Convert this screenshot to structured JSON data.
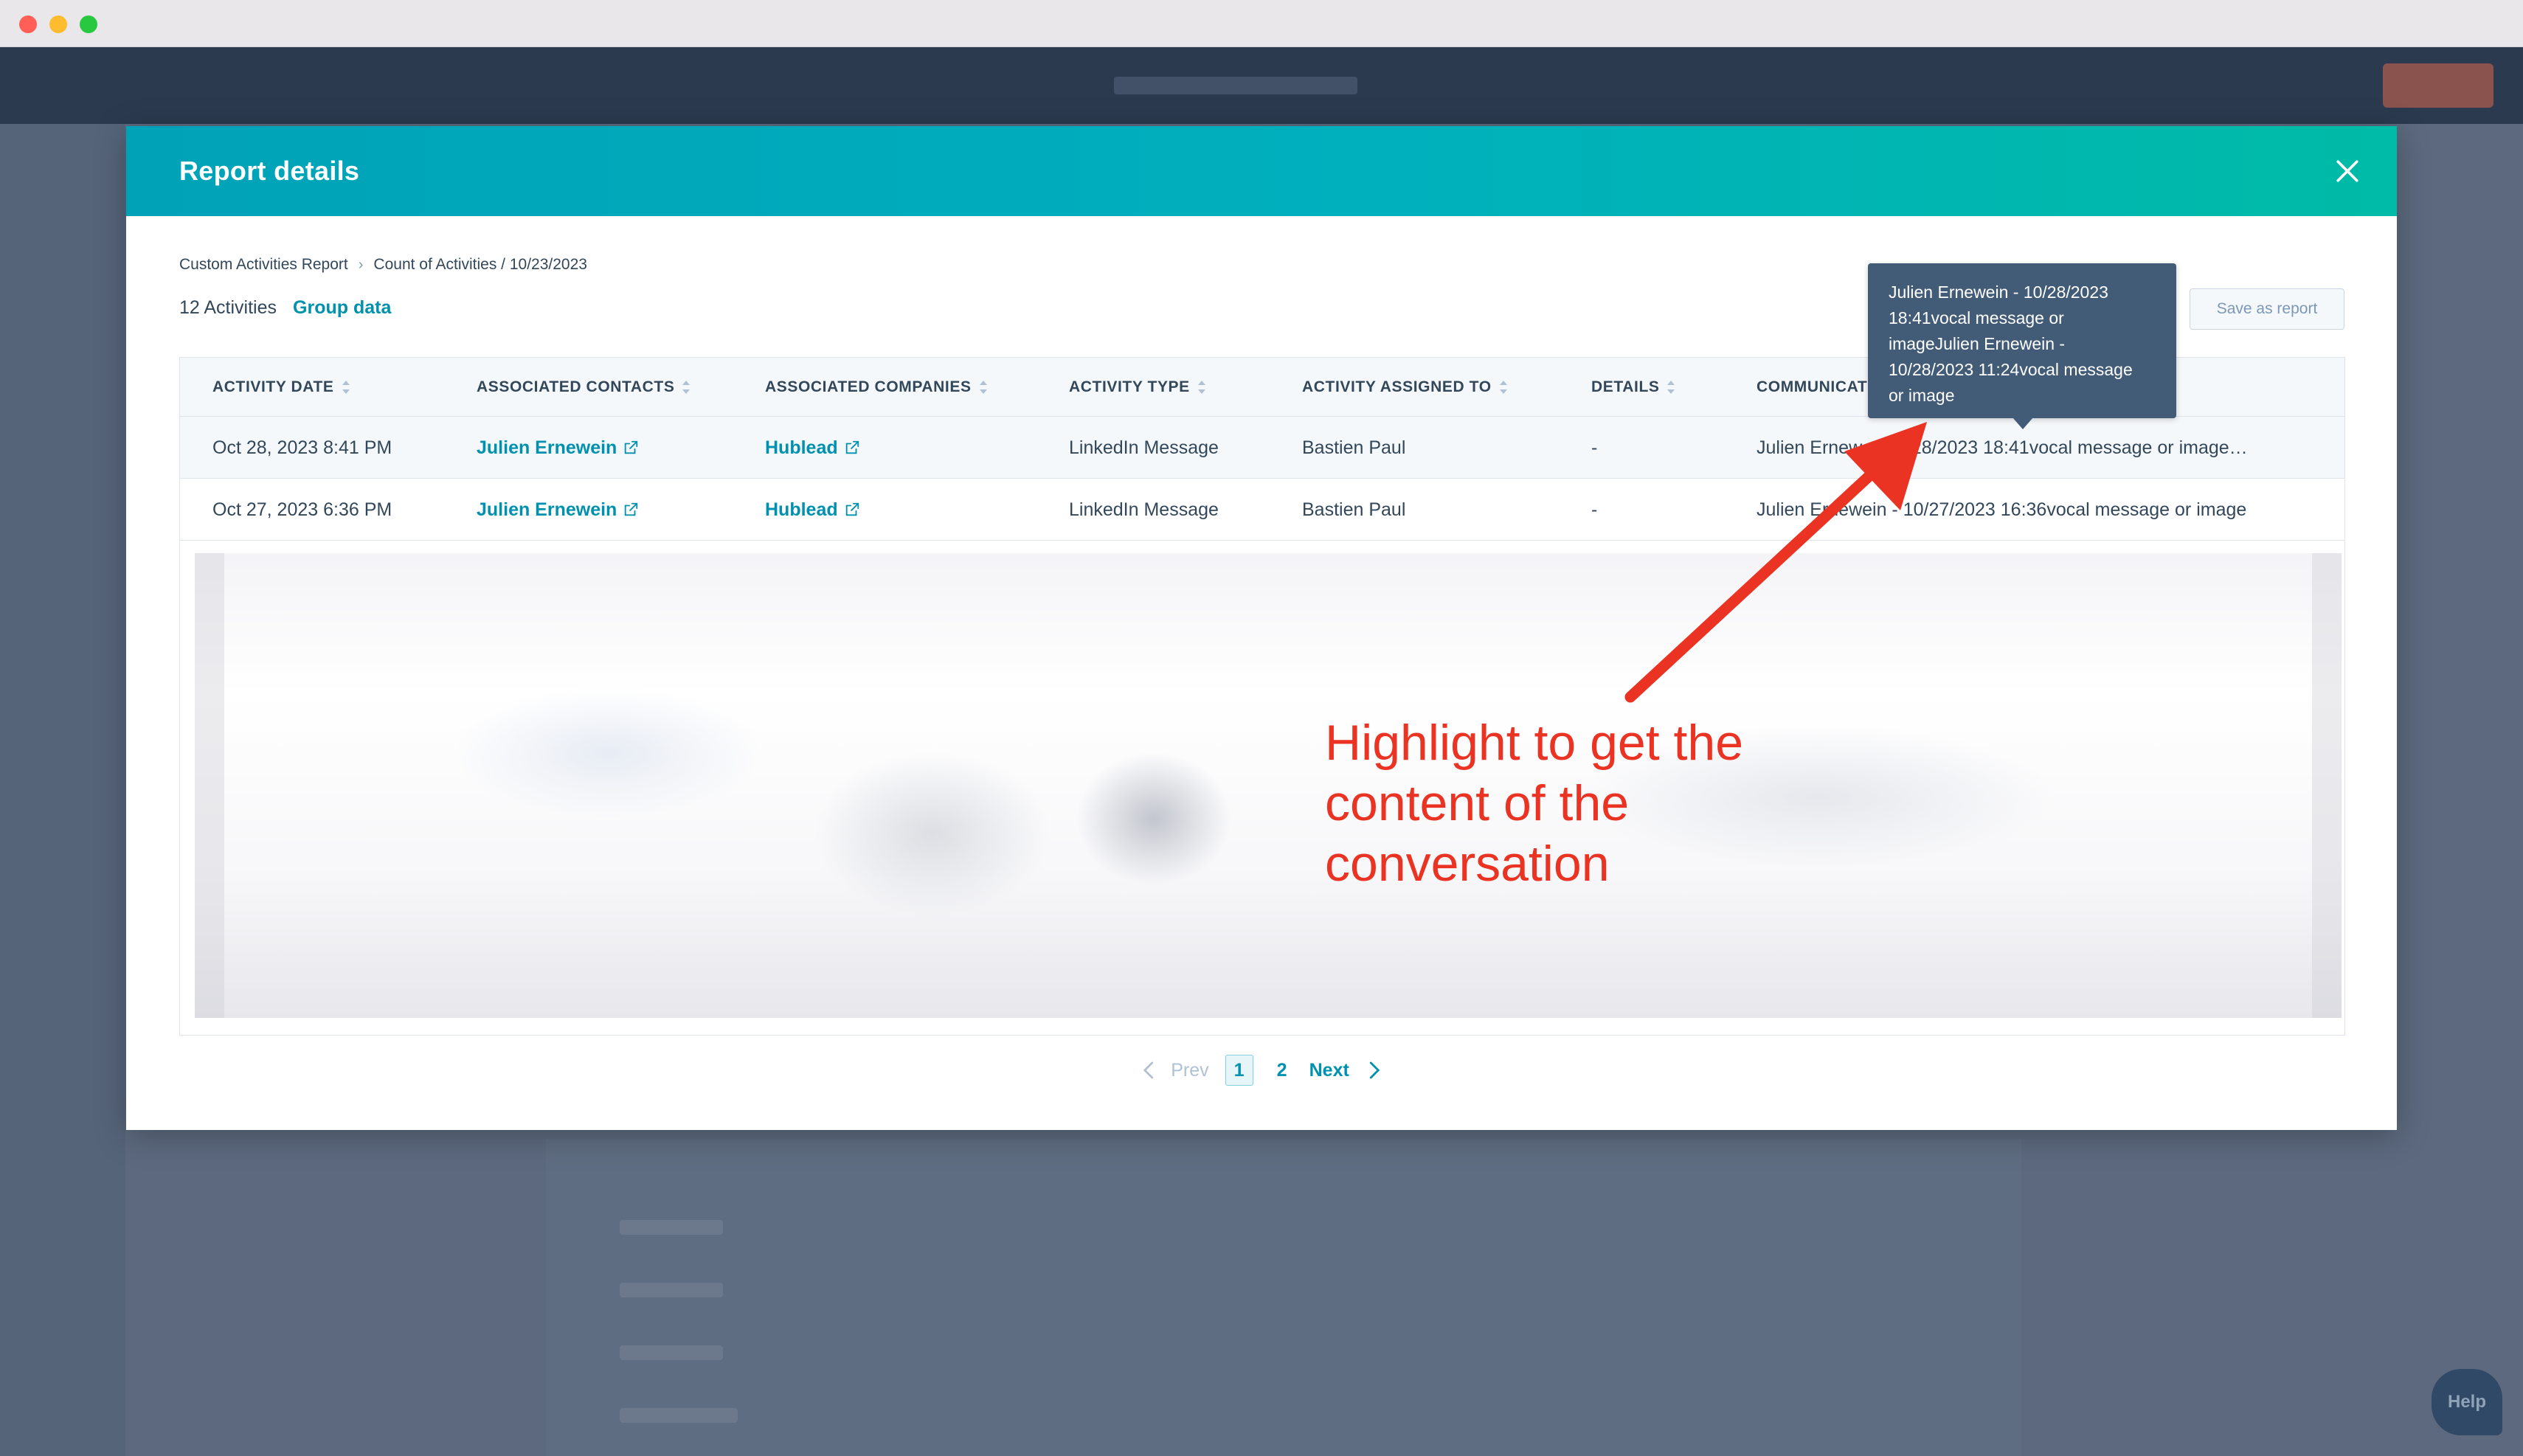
{
  "modal": {
    "title": "Report details",
    "breadcrumb": [
      "Custom Activities Report",
      "Count of Activities / 10/23/2023"
    ],
    "count_label": "12 Activities",
    "group_link": "Group data",
    "save_button": "Save as report"
  },
  "table": {
    "columns": [
      "ACTIVITY DATE",
      "ASSOCIATED CONTACTS",
      "ASSOCIATED COMPANIES",
      "ACTIVITY TYPE",
      "ACTIVITY ASSIGNED TO",
      "DETAILS",
      "COMMUNICAT"
    ],
    "rows": [
      {
        "date": "Oct 28, 2023 8:41 PM",
        "contact": "Julien Ernewein",
        "company": "Hublead",
        "type": "LinkedIn Message",
        "assigned": "Bastien Paul",
        "details": "-",
        "communication": "Julien Ernew… 10/28/2023 18:41vocal message or image…"
      },
      {
        "date": "Oct 27, 2023 6:36 PM",
        "contact": "Julien Ernewein",
        "company": "Hublead",
        "type": "LinkedIn Message",
        "assigned": "Bastien Paul",
        "details": "-",
        "communication": "Julien Ernewein - 10/27/2023 16:36vocal message or image"
      }
    ]
  },
  "tooltip": {
    "lines": [
      "Julien Ernewein - 10/28/2023",
      "18:41vocal message or",
      "imageJulien Ernewein -",
      "10/28/2023 11:24vocal message",
      "or image"
    ]
  },
  "pagination": {
    "prev": "Prev",
    "pages": [
      "1",
      "2"
    ],
    "current": "1",
    "next": "Next"
  },
  "annotation": {
    "text_lines": [
      "Highlight to get the",
      "content of the",
      "conversation"
    ],
    "color": "#ea3323"
  },
  "background_app": {
    "help_label": "Help"
  },
  "colors": {
    "header_gradient_start": "#00a2b8",
    "header_gradient_end": "#00bba7",
    "link": "#0091ae",
    "text": "#33475b",
    "tooltip_bg": "#425b76"
  }
}
